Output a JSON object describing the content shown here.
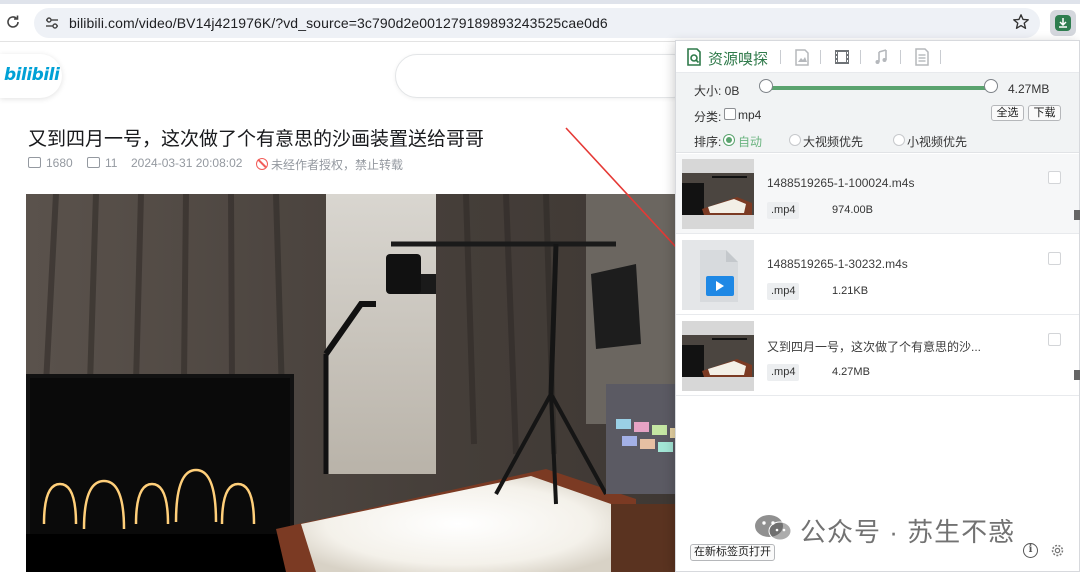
{
  "browser": {
    "url": "bilibili.com/video/BV14j421976K/?vd_source=3c790d2e001279189893243525cae0d6"
  },
  "site": {
    "logo": "bilibili"
  },
  "video": {
    "title": "又到四月一号，这次做了个有意思的沙画装置送给哥哥",
    "views": "1680",
    "danmaku": "11",
    "date": "2024-03-31 20:08:02",
    "notice": "未经作者授权，禁止转载"
  },
  "popup": {
    "title": "资源嗅探",
    "size_label": "大小: 0B",
    "size_max": "4.27MB",
    "category_label": "分类:",
    "category_option": "mp4",
    "select_all": "全选",
    "download": "下载",
    "sort_label": "排序:",
    "sort_options": [
      {
        "label": "自动",
        "selected": true
      },
      {
        "label": "大视频优先",
        "selected": false
      },
      {
        "label": "小视频优先",
        "selected": false
      }
    ],
    "items": [
      {
        "name": "1488519265-1-100024.m4s",
        "ext": ".mp4",
        "size": "974.00B",
        "thumb": "video-frame"
      },
      {
        "name": "1488519265-1-30232.m4s",
        "ext": ".mp4",
        "size": "1.21KB",
        "thumb": "file-icon"
      },
      {
        "name": "又到四月一号，这次做了个有意思的沙...",
        "ext": ".mp4",
        "size": "4.27MB",
        "thumb": "video-frame"
      }
    ],
    "open_new_tab": "在新标签页打开"
  },
  "watermark": {
    "text": "公众号 · 苏生不惑"
  },
  "colors": {
    "accent": "#5aa36e",
    "bilibili_blue": "#00a1d6",
    "arrow": "#e53935"
  }
}
